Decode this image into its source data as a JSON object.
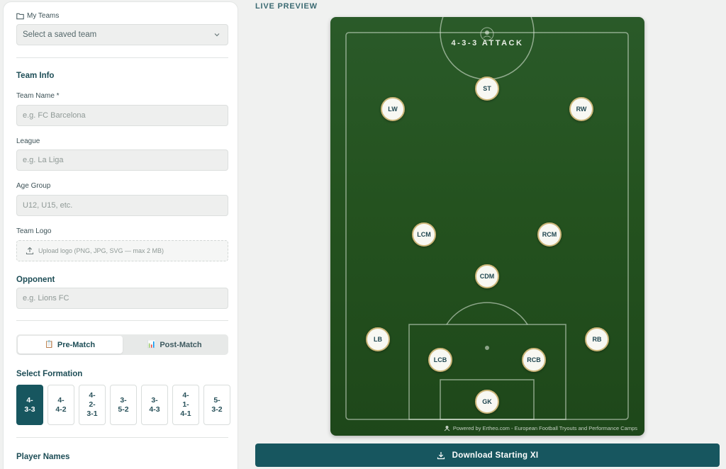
{
  "sidebar": {
    "my_teams_label": "My Teams",
    "saved_team_placeholder": "Select a saved team",
    "team_info_title": "Team Info",
    "team_name_label": "Team Name *",
    "team_name_placeholder": "e.g. FC Barcelona",
    "league_label": "League",
    "league_placeholder": "e.g. La Liga",
    "age_group_label": "Age Group",
    "age_group_placeholder": "U12, U15, etc.",
    "team_logo_label": "Team Logo",
    "upload_text": "Upload logo (PNG, JPG, SVG — max 2 MB)",
    "opponent_title": "Opponent",
    "opponent_placeholder": "e.g. Lions FC",
    "mode_toggle": [
      {
        "emoji": "📋",
        "label": "Pre-Match",
        "active": true
      },
      {
        "emoji": "📊",
        "label": "Post-Match",
        "active": false
      }
    ],
    "select_formation_title": "Select Formation",
    "formations": [
      {
        "label": "4-\n3-3",
        "active": true
      },
      {
        "label": "4-\n4-2",
        "active": false
      },
      {
        "label": "4-\n2-\n3-1",
        "active": false
      },
      {
        "label": "3-\n5-2",
        "active": false
      },
      {
        "label": "3-\n4-3",
        "active": false
      },
      {
        "label": "4-\n1-\n4-1",
        "active": false
      },
      {
        "label": "5-\n3-2",
        "active": false
      }
    ],
    "player_names_title": "Player Names"
  },
  "preview": {
    "label": "LIVE PREVIEW",
    "formation_title": "4-3-3 ATTACK",
    "players": [
      {
        "pos": "ST"
      },
      {
        "pos": "LW"
      },
      {
        "pos": "RW"
      },
      {
        "pos": "LCM"
      },
      {
        "pos": "RCM"
      },
      {
        "pos": "CDM"
      },
      {
        "pos": "LB"
      },
      {
        "pos": "RB"
      },
      {
        "pos": "LCB"
      },
      {
        "pos": "RCB"
      },
      {
        "pos": "GK"
      }
    ],
    "powered_by": "Powered by Ertheo.com - European Football Tryouts and Performance Camps"
  },
  "download_label": "Download Starting XI",
  "colors": {
    "accent": "#17565f",
    "pitch": "#24521f",
    "player_ring": "#cdb77a"
  }
}
